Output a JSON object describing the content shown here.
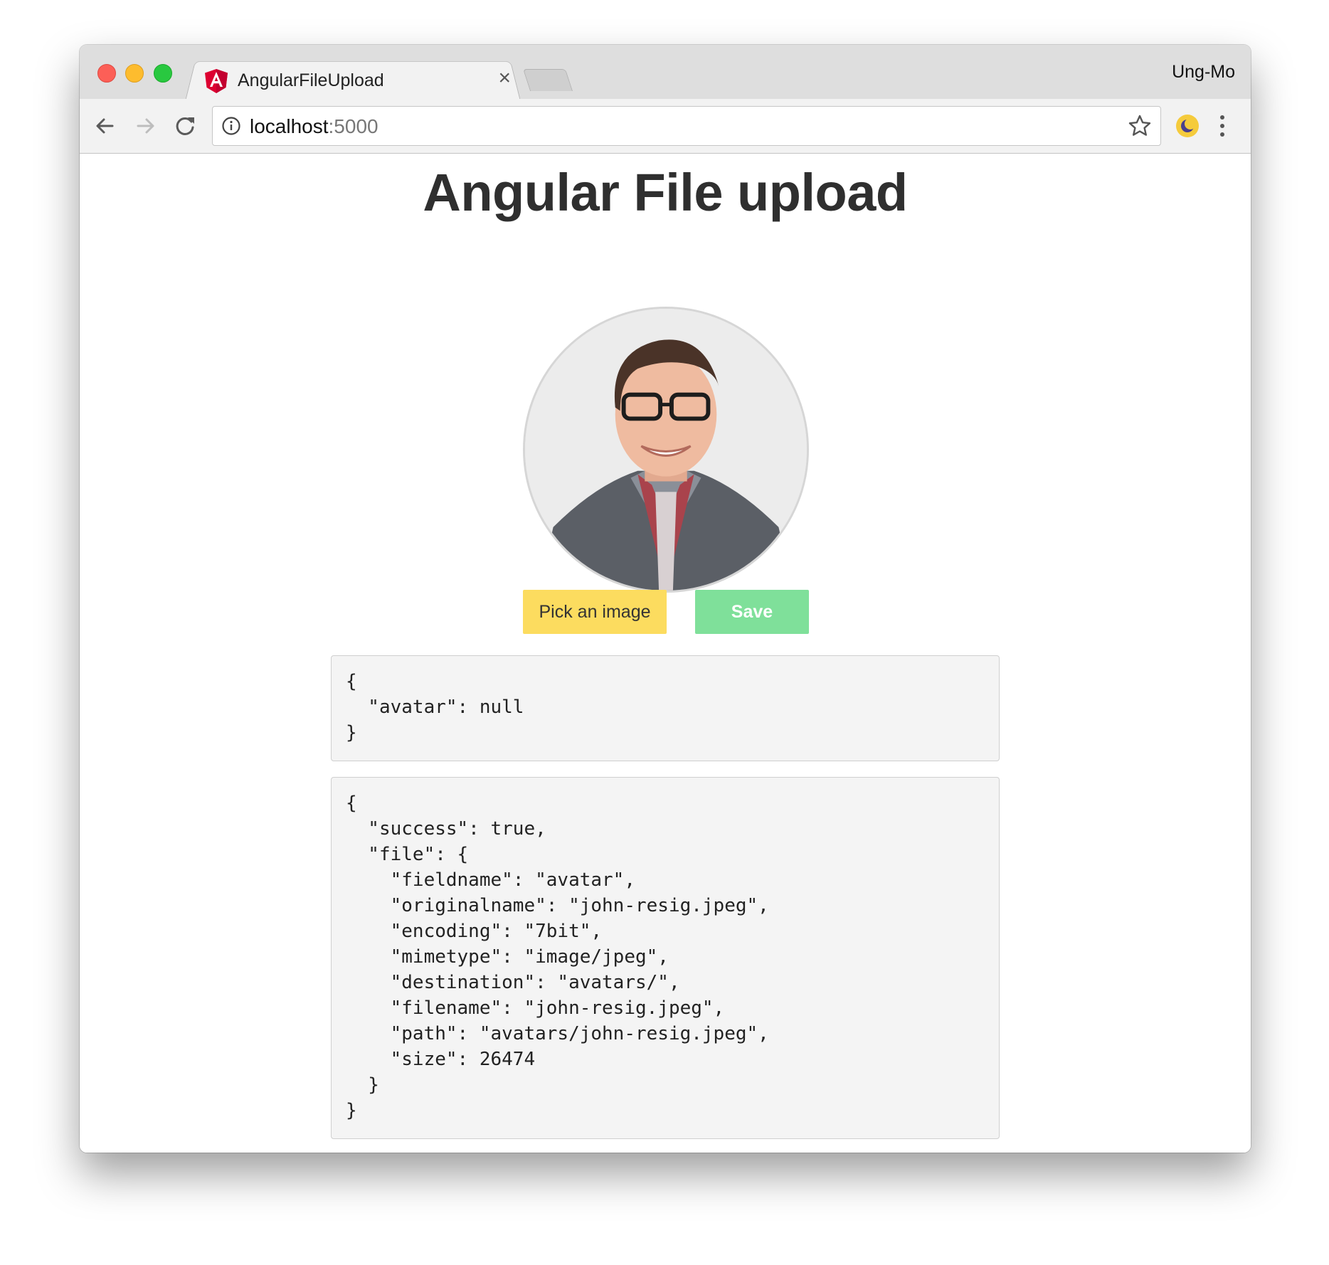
{
  "browser": {
    "tab_title": "AngularFileUpload",
    "tab_close_glyph": "×",
    "profile_name": "Ung-Mo",
    "url_host": "localhost",
    "url_port": ":5000",
    "icons": {
      "back": "arrow-left-icon",
      "forward": "arrow-right-icon",
      "reload": "reload-icon",
      "info": "info-icon",
      "bookmark": "star-icon",
      "extension": "moon-extension-icon",
      "menu": "kebab-menu-icon",
      "favicon": "angular-logo-icon"
    }
  },
  "page": {
    "title": "Angular File upload",
    "pick_button_label": "Pick an image",
    "save_button_label": "Save",
    "form_value_json": "{\n  \"avatar\": null\n}",
    "response_json": "{\n  \"success\": true,\n  \"file\": {\n    \"fieldname\": \"avatar\",\n    \"originalname\": \"john-resig.jpeg\",\n    \"encoding\": \"7bit\",\n    \"mimetype\": \"image/jpeg\",\n    \"destination\": \"avatars/\",\n    \"filename\": \"john-resig.jpeg\",\n    \"path\": \"avatars/john-resig.jpeg\",\n    \"size\": 26474\n  }\n}"
  },
  "colors": {
    "pick_button": "#fcdc5f",
    "save_button": "#7fe09a",
    "angular_red": "#dd0031"
  }
}
